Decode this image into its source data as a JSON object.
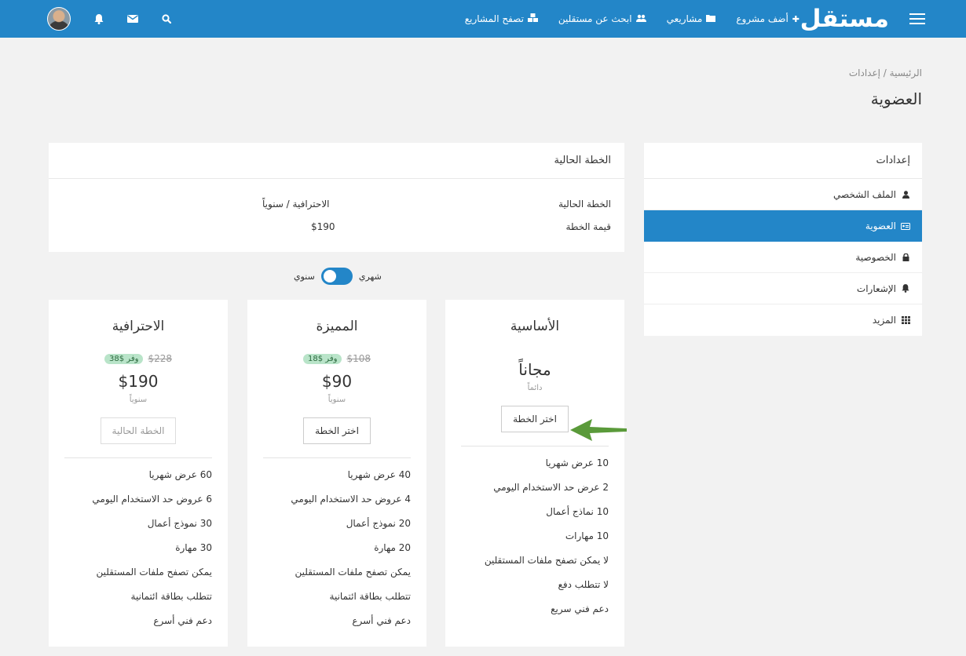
{
  "nav": {
    "logo": "مستقل",
    "links": [
      {
        "label": "أضف مشروع",
        "icon": "plus-icon"
      },
      {
        "label": "مشاريعي",
        "icon": "folder-icon"
      },
      {
        "label": "ابحث عن مستقلين",
        "icon": "users-icon"
      },
      {
        "label": "تصفح المشاريع",
        "icon": "cubes-icon"
      }
    ]
  },
  "breadcrumb": {
    "home": "الرئيسية",
    "separator": "/",
    "current": "إعدادات"
  },
  "page_title": "العضوية",
  "sidebar": {
    "heading": "إعدادات",
    "items": [
      {
        "label": "الملف الشخصي",
        "icon": "user-icon"
      },
      {
        "label": "العضوية",
        "icon": "id-card-icon",
        "active": true
      },
      {
        "label": "الخصوصية",
        "icon": "lock-icon"
      },
      {
        "label": "الإشعارات",
        "icon": "bell-icon"
      },
      {
        "label": "المزيد",
        "icon": "grid-icon"
      }
    ]
  },
  "current_plan": {
    "heading": "الخطة الحالية",
    "rows": [
      {
        "label": "الخطة الحالية",
        "value": "الاحترافية / سنوياً"
      },
      {
        "label": "قيمة الخطة",
        "value": "$190"
      }
    ]
  },
  "billing_toggle": {
    "monthly": "شهري",
    "yearly": "سنوي"
  },
  "plans": [
    {
      "name": "الأساسية",
      "price": "مجاناً",
      "period": "دائماً",
      "button": "اختر الخطة",
      "features": [
        "10 عرض شهريا",
        "2 عرض حد الاستخدام اليومي",
        "10 نماذج أعمال",
        "10 مهارات",
        "لا يمكن تصفح ملفات المستقلين",
        "لا تتطلب دفع",
        "دعم فني سريع"
      ]
    },
    {
      "name": "المميزة",
      "old_price": "$108",
      "save": "وفر $18",
      "price": "$90",
      "period": "سنوياً",
      "button": "اختر الخطة",
      "features": [
        "40 عرض شهريا",
        "4 عروض حد الاستخدام اليومي",
        "20 نموذج أعمال",
        "20 مهارة",
        "يمكن تصفح ملفات المستقلين",
        "تتطلب بطاقة ائتمانية",
        "دعم فني أسرع"
      ]
    },
    {
      "name": "الاحترافية",
      "old_price": "$228",
      "save": "وفر $38",
      "price": "$190",
      "period": "سنوياً",
      "button": "الخطة الحالية",
      "features": [
        "60 عرض شهريا",
        "6 عروض حد الاستخدام اليومي",
        "30 نموذج أعمال",
        "30 مهارة",
        "يمكن تصفح ملفات المستقلين",
        "تتطلب بطاقة ائتمانية",
        "دعم فني أسرع"
      ]
    }
  ],
  "colors": {
    "brand": "#2386c8",
    "arrow": "#5a9a3a",
    "save_badge": "#b9e4c9"
  }
}
